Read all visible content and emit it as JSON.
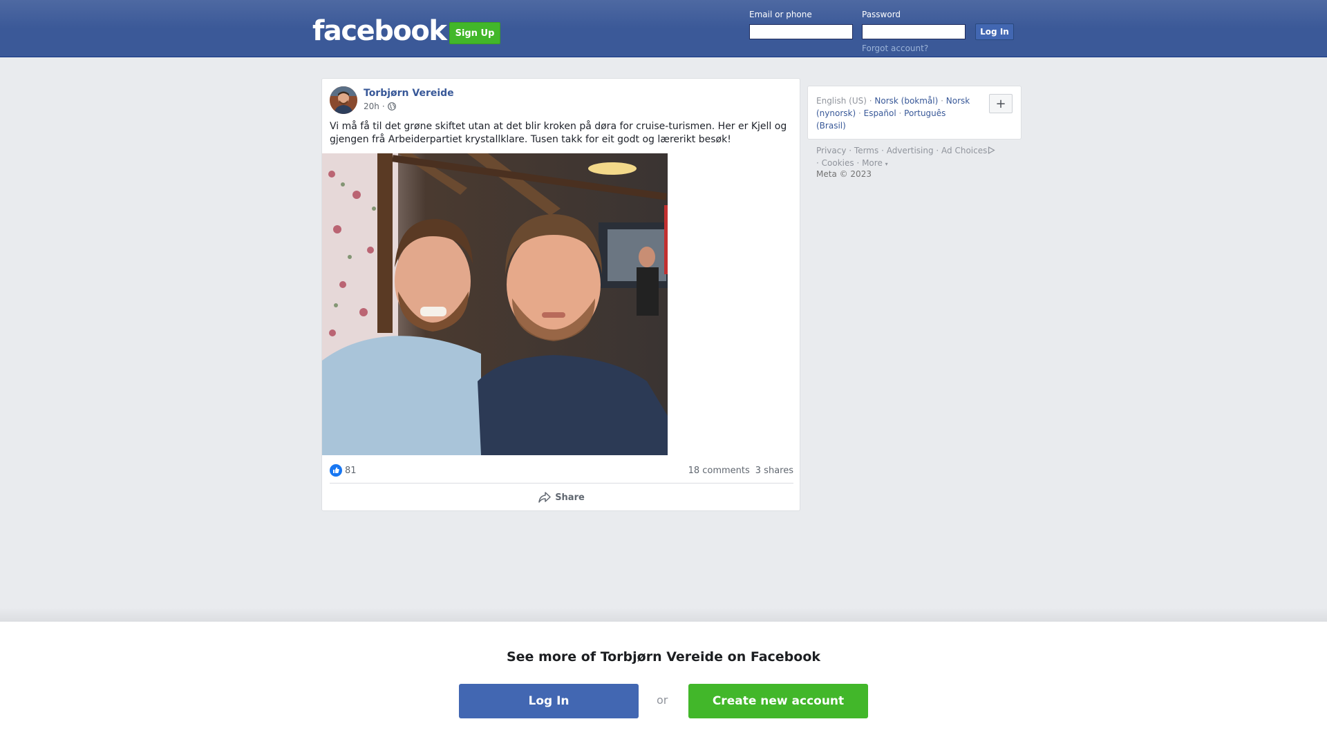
{
  "header": {
    "logo": "facebook",
    "signup_label": "Sign Up",
    "email_label": "Email or phone",
    "email_value": "",
    "password_label": "Password",
    "password_value": "",
    "login_label": "Log In",
    "forgot_label": "Forgot account?"
  },
  "post": {
    "author": "Torbjørn Vereide",
    "time": "20h",
    "privacy_icon": "globe-icon",
    "text": "Vi må få til det grøne skiftet utan at det blir kroken på døra for cruise-turismen. Her er Kjell og gjengen frå Arbeiderpartiet krystallklare. Tusen takk for eit godt og lærerikt besøk!",
    "reactions_count": "81",
    "comments": "18 comments",
    "shares": "3 shares",
    "share_label": "Share"
  },
  "sidebar": {
    "languages": {
      "current": "English (US)",
      "norsk_bokmal": "Norsk (bokmål)",
      "norsk_nynorsk": "Norsk (nynorsk)",
      "espanol": "Español",
      "portugues": "Português (Brasil)",
      "more_icon": "plus-icon"
    },
    "footer": {
      "privacy": "Privacy",
      "terms": "Terms",
      "advertising": "Advertising",
      "ad_choices": "Ad Choices",
      "cookies": "Cookies",
      "more": "More",
      "copyright": "Meta © 2023"
    }
  },
  "banner": {
    "title": "See more of Torbjørn Vereide on Facebook",
    "login_label": "Log In",
    "or_label": "or",
    "create_label": "Create new account"
  },
  "colors": {
    "brand_blue": "#4267b2",
    "header_blue": "#3b5998",
    "green": "#42b72a",
    "link": "#385898"
  }
}
